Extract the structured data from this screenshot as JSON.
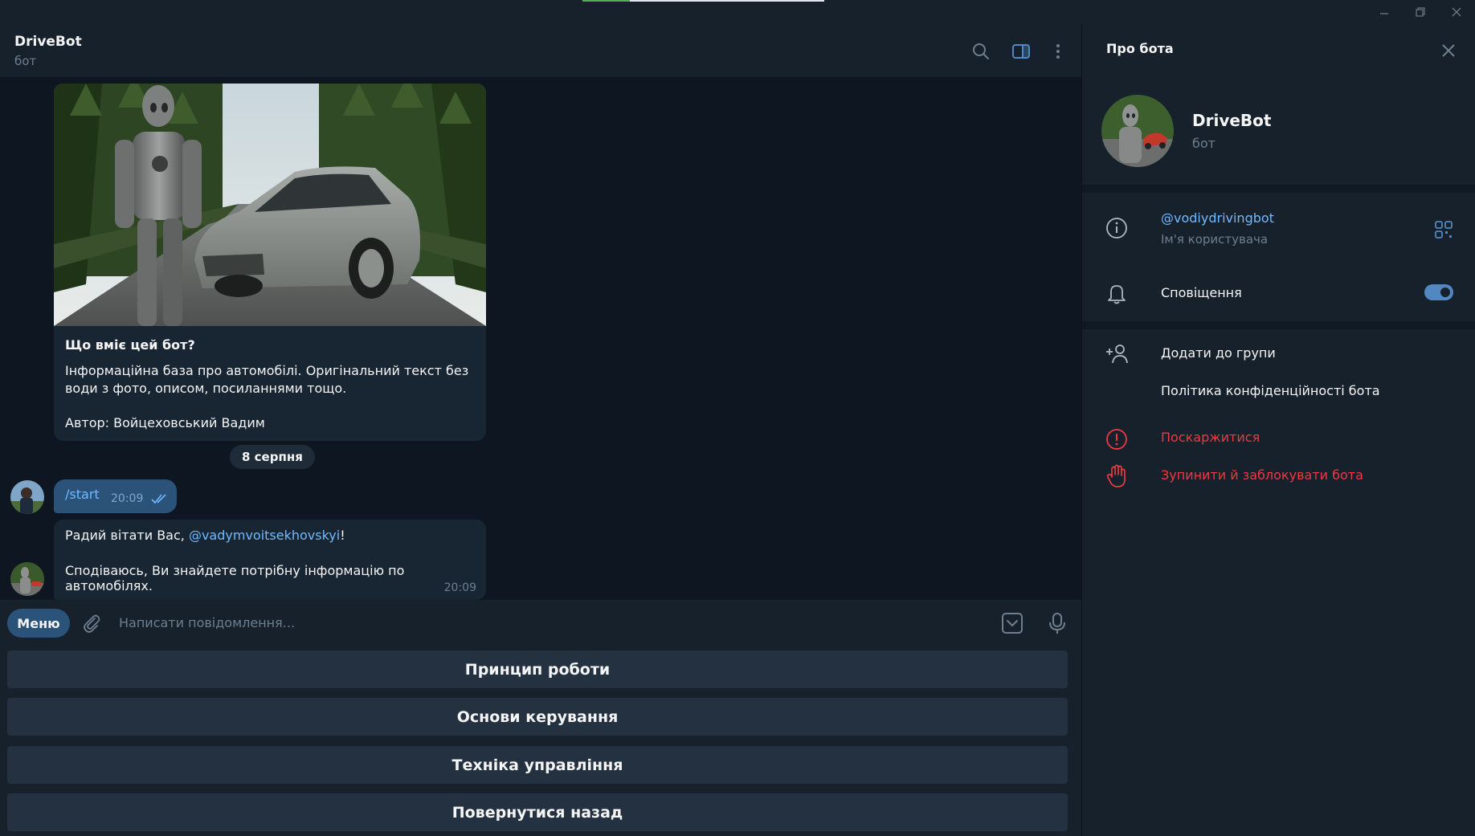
{
  "window": {
    "minimize_icon": "minimize-icon",
    "maximize_icon": "restore-icon",
    "close_icon": "close-icon",
    "loading_progress": 0.2
  },
  "chat": {
    "title": "DriveBot",
    "status": "бот",
    "header_icons": [
      "search-icon",
      "sidebar-toggle-icon",
      "more-vertical-icon"
    ]
  },
  "intro": {
    "heading": "Що вміє цей бот?",
    "text": "Інформаційна база про автомобілі. Оригінальний текст без води з фото, описом, посиланнями тощо.",
    "author": "Автор: Войцеховський Вадим"
  },
  "date_separator": "8 серпня",
  "messages": [
    {
      "direction": "outgoing",
      "text": "/start",
      "time": "20:09",
      "read": true
    },
    {
      "direction": "incoming",
      "greeting_prefix": "Радий вітати Вас, ",
      "mention": "@vadymvoitsekhovskyi",
      "greeting_suffix": "!",
      "text": "Сподіваюсь, Ви знайдете потрібну інформацію по автомобілях.",
      "time": "20:09"
    }
  ],
  "composer": {
    "menu_label": "Меню",
    "placeholder": "Написати повідомлення...",
    "icons": [
      "attach-icon",
      "keyboard-toggle-icon",
      "microphone-icon"
    ]
  },
  "keyboard": [
    "Принцип роботи",
    "Основи керування",
    "Техніка управління",
    "Повернутися назад"
  ],
  "side_panel": {
    "title": "Про бота",
    "name": "DriveBot",
    "status": "бот",
    "username": "@vodiydrivingbot",
    "username_caption": "Ім'я користувача",
    "notifications_label": "Сповіщення",
    "notifications_on": true,
    "add_to_group": "Додати до групи",
    "privacy_policy": "Політика конфіденційності бота",
    "report": "Поскаржитися",
    "block": "Зупинити й заблокувати бота",
    "colors": {
      "accent": "#5288c1",
      "link": "#71baff",
      "danger": "#ec3942"
    }
  }
}
